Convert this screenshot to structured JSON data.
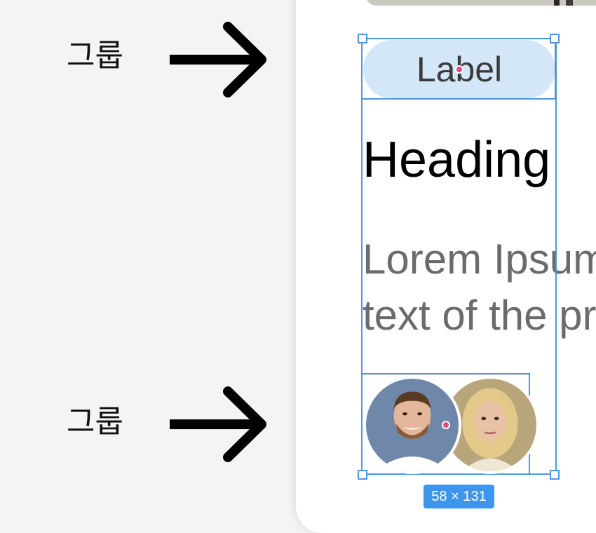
{
  "annotations": {
    "group_label_top": "그룹",
    "group_label_bottom": "그룹"
  },
  "card": {
    "label": "Label",
    "heading": "Heading",
    "body_line1": "Lorem Ipsum is simply dummy",
    "body_line2": "text of the printing industry",
    "avatars": [
      "avatar-man",
      "avatar-woman"
    ]
  },
  "selection": {
    "size": "58 × 131"
  },
  "colors": {
    "selection": "#4d96e6",
    "pill": "#d4e7f8",
    "badge": "#3d95ec"
  }
}
